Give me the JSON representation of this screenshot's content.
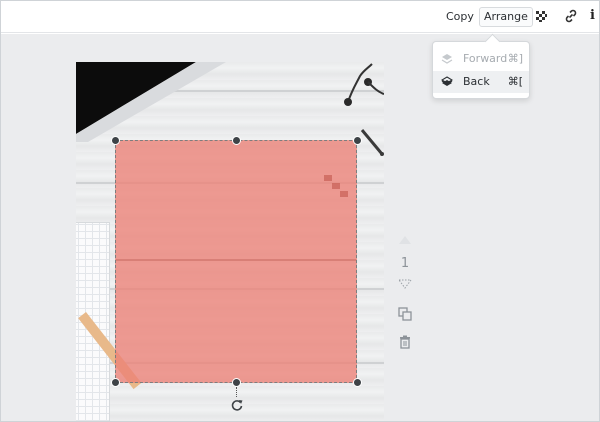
{
  "toolbar": {
    "copy_label": "Copy",
    "arrange_label": "Arrange",
    "info_label": "i",
    "icons": [
      "transparency-icon",
      "link-icon",
      "info-icon"
    ]
  },
  "arrange_menu": {
    "items": [
      {
        "label": "Forward",
        "shortcut": "⌘]",
        "enabled": false,
        "icon": "layer-forward-icon"
      },
      {
        "label": "Back",
        "shortcut": "⌘[",
        "enabled": true,
        "icon": "layer-back-icon"
      }
    ]
  },
  "side_controls": {
    "page_number": "1",
    "icons": [
      "move-up-icon",
      "move-down-icon",
      "duplicate-icon",
      "trash-icon"
    ]
  },
  "colors": {
    "shape_fill": "#ec8076",
    "handle": "#3e4347",
    "workspace": "#ebecee"
  }
}
